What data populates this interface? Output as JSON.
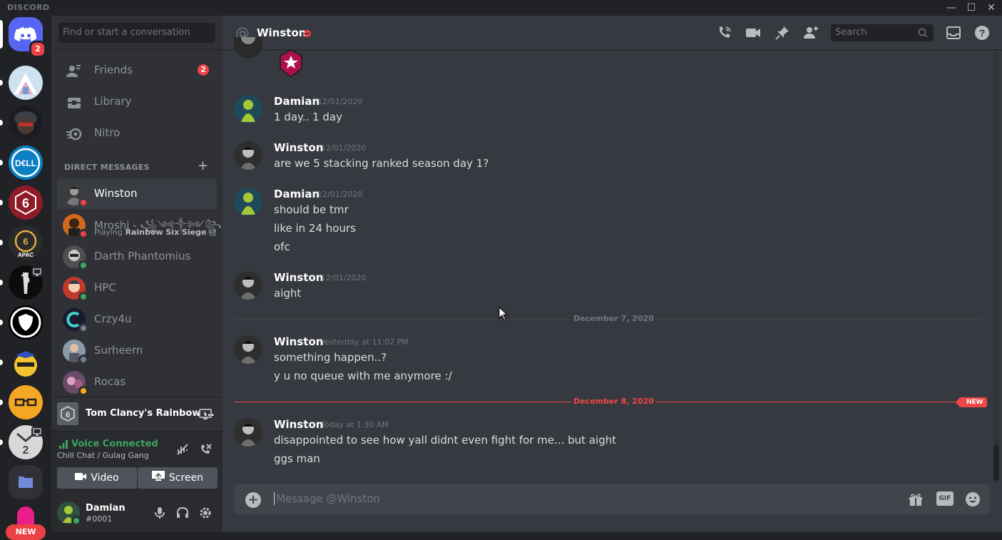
{
  "window": {
    "brand": "DISCORD",
    "minimize": "—",
    "maximize": "☐",
    "close": "✕"
  },
  "servers": {
    "home_badge": "2",
    "new_label": "NEW"
  },
  "sidebar": {
    "search_placeholder": "Find or start a conversation",
    "nav": [
      {
        "label": "Friends",
        "badge": "2",
        "icon": "friends-icon"
      },
      {
        "label": "Library",
        "icon": "library-icon"
      },
      {
        "label": "Nitro",
        "icon": "nitro-icon"
      }
    ],
    "dm_header": "DIRECT MESSAGES",
    "dm_add": "+",
    "dms": [
      {
        "name": "Winston",
        "status": "dnd",
        "active": true
      },
      {
        "name": "Mroshi - ꧁༺༒༻꧂...",
        "status": "dnd",
        "sub_prefix": "Playing ",
        "sub_game": "Rainbow Six Siege"
      },
      {
        "name": "Darth Phantomius",
        "status": "online"
      },
      {
        "name": "HPC",
        "status": "online"
      },
      {
        "name": "Crzy4u",
        "status": "offline"
      },
      {
        "name": "Surheern",
        "status": "offline"
      },
      {
        "name": "Rocas",
        "status": "idle"
      }
    ],
    "activity": {
      "title": "Tom Clancy's Rainbow ..."
    },
    "voice": {
      "status": "Voice Connected",
      "channel": "Chill Chat / Gulag Gang",
      "video_label": "Video",
      "screen_label": "Screen"
    },
    "user": {
      "name": "Damian",
      "tag": "#0001"
    }
  },
  "chat": {
    "title": "Winston",
    "search_placeholder": "Search",
    "messages": [
      {
        "author": "Damian",
        "time": "12/01/2020",
        "lines": [
          "1 day.. 1 day"
        ]
      },
      {
        "author": "Winston",
        "time": "12/01/2020",
        "lines": [
          "are we 5 stacking ranked season day 1?"
        ]
      },
      {
        "author": "Damian",
        "time": "12/01/2020",
        "lines": [
          "should be tmr",
          "like in 24 hours",
          "ofc"
        ]
      },
      {
        "author": "Winston",
        "time": "12/01/2020",
        "lines": [
          "aight"
        ]
      },
      {
        "author": "Winston",
        "time": "Yesterday at 11:02 PM",
        "lines": [
          "something happen..?",
          "y u no queue with me anymore :/"
        ]
      },
      {
        "author": "Winston",
        "time": "Today at 1:30 AM",
        "lines": [
          "disappointed to see how yall didnt even fight for me... but aight",
          "ggs man"
        ]
      }
    ],
    "dividers": {
      "first": "December 7, 2020",
      "second": "December 8, 2020",
      "new_tag": "NEW"
    },
    "composer_placeholder": "Message @Winston",
    "gif_label": "GIF"
  },
  "colors": {
    "online": "#3ba55d",
    "dnd": "#ed4245",
    "idle": "#faa81a",
    "offline": "#747f8d",
    "blurple": "#5865f2"
  }
}
